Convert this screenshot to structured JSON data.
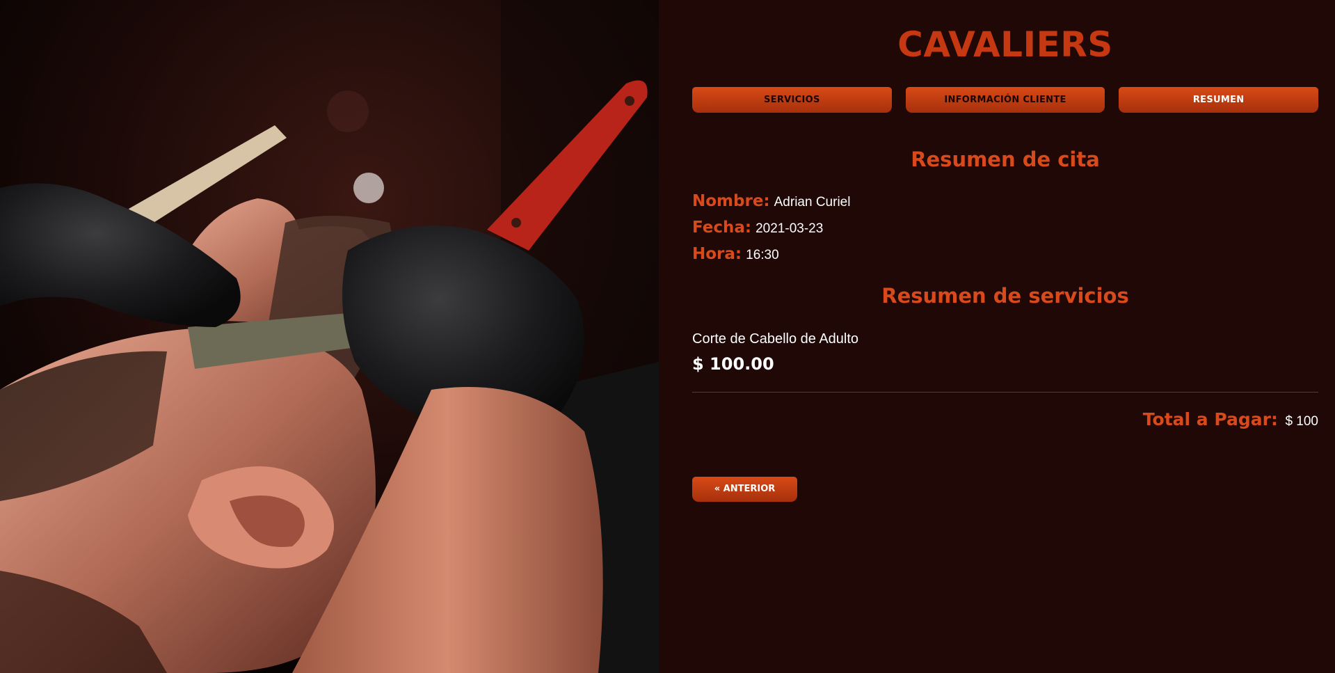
{
  "brand": {
    "name": "CAVALIERS"
  },
  "tabs": [
    {
      "label": "SERVICIOS",
      "active": false
    },
    {
      "label": "INFORMACIÓN CLIENTE",
      "active": false
    },
    {
      "label": "RESUMEN",
      "active": true
    }
  ],
  "summary": {
    "title": "Resumen de cita",
    "fields": [
      {
        "label": "Nombre:",
        "value": "Adrian Curiel"
      },
      {
        "label": "Fecha:",
        "value": "2021-03-23"
      },
      {
        "label": "Hora:",
        "value": "16:30"
      }
    ]
  },
  "services": {
    "title": "Resumen de servicios",
    "items": [
      {
        "name": "Corte de Cabello de Adulto",
        "price": "$ 100.00"
      }
    ]
  },
  "total": {
    "label": "Total a Pagar:",
    "value": "$ 100"
  },
  "navigation": {
    "prev_label": "« ANTERIOR"
  },
  "colors": {
    "background": "#1f0806",
    "accent": "#d84a1c",
    "button": "#c63812",
    "text": "#ffffff"
  }
}
